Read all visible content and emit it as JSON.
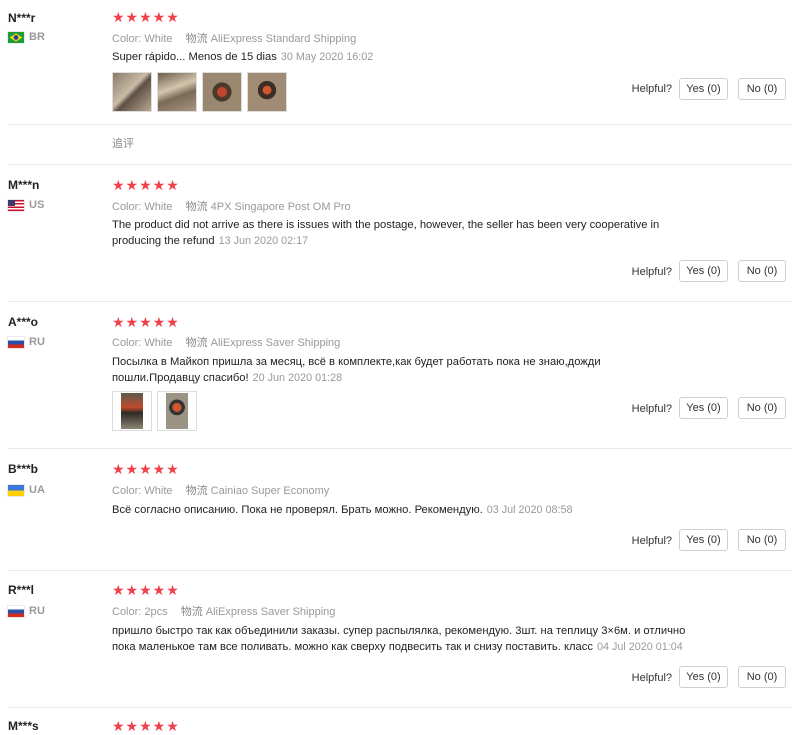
{
  "labels": {
    "color": "Color:",
    "shipping": "物流",
    "helpful": "Helpful?",
    "stars": "★★★★★",
    "append": "追评"
  },
  "reviews": [
    {
      "user": "N***r",
      "country": "BR",
      "color": "White",
      "shipping": "AliExpress Standard Shipping",
      "text": "Super rápido... Menos de 15 dias",
      "date": "30 May 2020 16:02",
      "yes": "Yes (0)",
      "no": "No (0)"
    },
    {
      "user": "M***n",
      "country": "US",
      "color": "White",
      "shipping": "4PX Singapore Post OM Pro",
      "text": "The product did not arrive as there is issues with the postage, however, the seller has been very cooperative in producing the refund",
      "date": "13 Jun 2020 02:17",
      "yes": "Yes (0)",
      "no": "No (0)"
    },
    {
      "user": "A***o",
      "country": "RU",
      "color": "White",
      "shipping": "AliExpress Saver Shipping",
      "text": "Посылка в Майкоп пришла за месяц, всё в комплекте,как будет работать пока не знаю,дожди пошли.Продавцу спасибо!",
      "date": "20 Jun 2020 01:28",
      "yes": "Yes (0)",
      "no": "No (0)"
    },
    {
      "user": "B***b",
      "country": "UA",
      "color": "White",
      "shipping": "Cainiao Super Economy",
      "text": "Всё согласно описанию. Пока не проверял. Брать можно. Рекомендую.",
      "date": "03 Jul 2020 08:58",
      "yes": "Yes (0)",
      "no": "No (0)"
    },
    {
      "user": "R***l",
      "country": "RU",
      "color": "2pcs",
      "shipping": "AliExpress Saver Shipping",
      "text": "пришло быстро так как объединили заказы. супер распылялка, рекомендую. 3шт. на теплицу 3×6м. и отлично пока маленькое там все поливать. можно как сверху подвесить так и снизу поставить. класс",
      "date": "04 Jul 2020 01:04",
      "yes": "Yes (0)",
      "no": "No (0)"
    },
    {
      "user": "M***s"
    }
  ]
}
